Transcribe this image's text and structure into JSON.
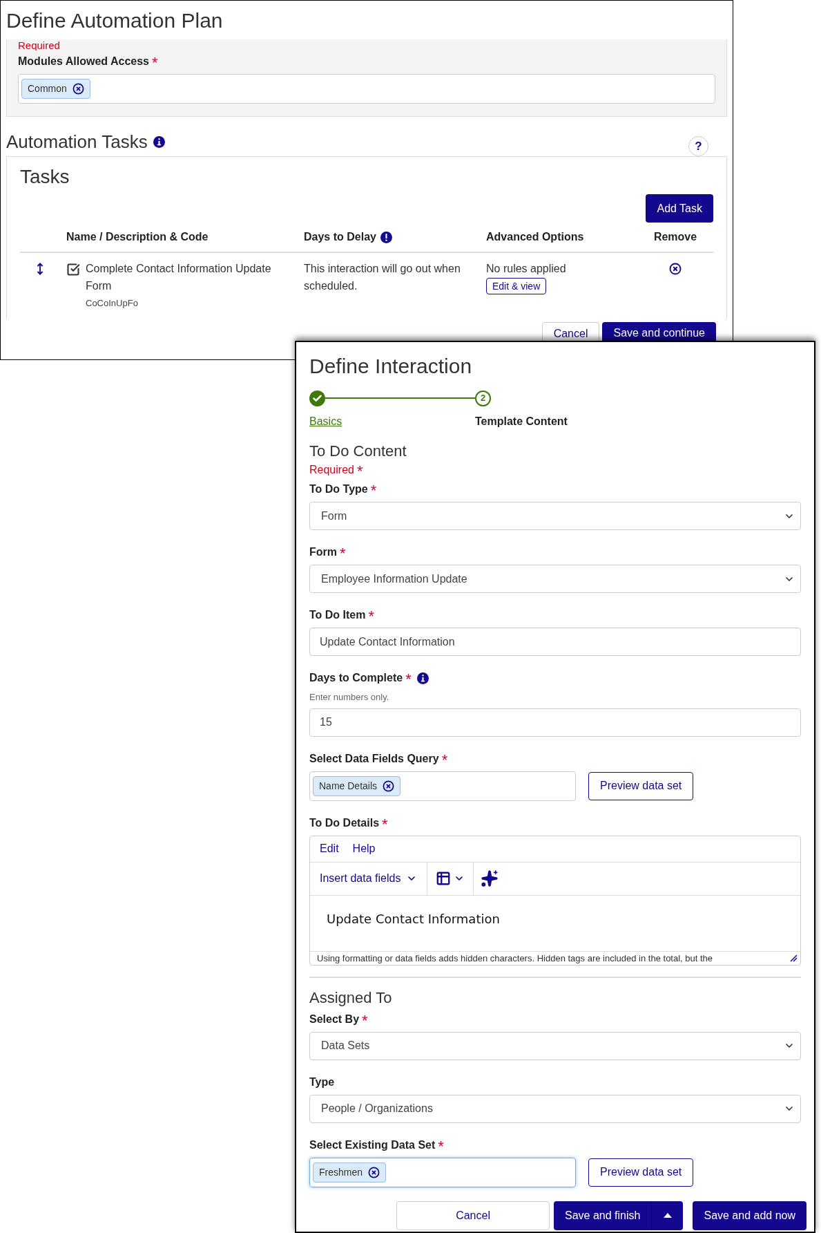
{
  "automation_plan": {
    "title": "Define Automation Plan",
    "required_note": "Required",
    "required_mark": "*",
    "modules_field": {
      "label": "Modules Allowed Access",
      "required": true,
      "chips": [
        "Common"
      ]
    },
    "tasks_section": {
      "title": "Automation Tasks",
      "help_button": "?",
      "panel_title": "Tasks",
      "add_button": "Add Task",
      "columns": [
        "Name / Description & Code",
        "Days to Delay",
        "Advanced Options",
        "Remove"
      ],
      "rows": [
        {
          "name": "Complete Contact Information Update Form",
          "code": "CoCoInUpFo",
          "checked": true,
          "delay": "This interaction will go out when scheduled.",
          "advanced": "No rules applied",
          "edit_button": "Edit & view"
        }
      ]
    },
    "buttons": [
      "Cancel",
      "Save and continue"
    ]
  },
  "interaction": {
    "title": "Define Interaction",
    "required_mark": "*",
    "steps": [
      {
        "label": "Basics",
        "completed": true
      },
      {
        "label": "Template Content",
        "number": "2",
        "completed": false
      }
    ],
    "sections": [
      {
        "title": "To Do Content",
        "required_note": "Required",
        "fields": [
          {
            "kind": "select",
            "label": "To Do Type",
            "required": true,
            "value": "Form"
          },
          {
            "kind": "select",
            "label": "Form",
            "required": true,
            "value": "Employee Information Update"
          },
          {
            "kind": "text",
            "label": "To Do Item",
            "required": true,
            "value": "Update Contact Information"
          },
          {
            "kind": "text",
            "label": "Days to Complete",
            "required": true,
            "info": true,
            "hint": "Enter numbers only.",
            "value": "15"
          },
          {
            "kind": "chips",
            "label": "Select Data Fields Query",
            "required": true,
            "chips": [
              "Name Details"
            ],
            "action": "Preview data set",
            "focused": false
          },
          {
            "kind": "editor",
            "label": "To Do Details",
            "required": true,
            "menu": [
              "Edit",
              "Help"
            ],
            "insert_label": "Insert data fields",
            "body": "Update Contact Information",
            "footer_note": "Using formatting or data fields adds hidden characters. Hidden tags are included in the total, but the"
          }
        ]
      },
      {
        "title": "Assigned To",
        "fields": [
          {
            "kind": "select",
            "label": "Select By",
            "required": true,
            "value": "Data Sets"
          },
          {
            "kind": "select",
            "label": "Type",
            "required": false,
            "value": "People / Organizations"
          },
          {
            "kind": "chips",
            "label": "Select Existing Data Set",
            "required": true,
            "chips": [
              "Freshmen"
            ],
            "action": "Preview data set",
            "focused": true
          }
        ]
      }
    ],
    "buttons": {
      "cancel": "Cancel",
      "primary": "Save and finish",
      "secondary": "Save and add now"
    }
  }
}
